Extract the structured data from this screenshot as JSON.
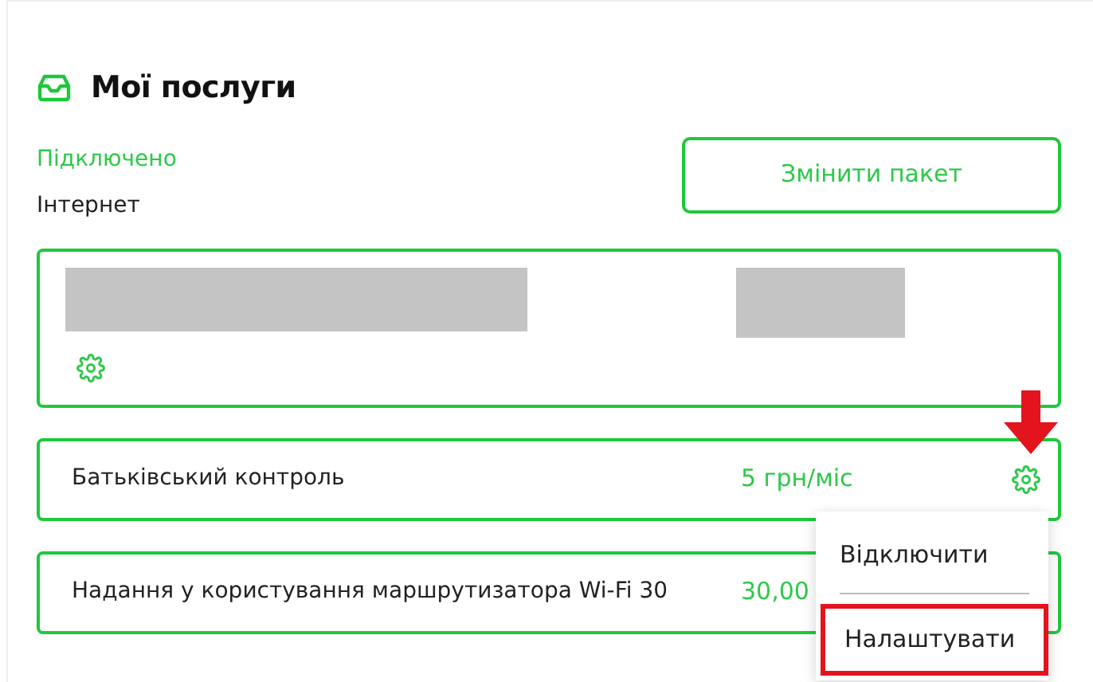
{
  "section": {
    "title": "Мої послуги"
  },
  "status": "Підключено",
  "service_type": "Інтернет",
  "change_button": "Змінити пакет",
  "services": [
    {
      "kind": "redacted"
    },
    {
      "kind": "addon",
      "name": "Батьківський контроль",
      "price": "5 грн/міс",
      "pointed": true
    },
    {
      "kind": "addon",
      "name": "Надання у користування маршрутизатора Wi-Fi 30",
      "price": "30,00",
      "pointed": false
    }
  ],
  "menu": {
    "items": [
      {
        "label": "Відключити",
        "highlighted": false
      },
      {
        "label": "Налаштувати",
        "highlighted": true
      }
    ]
  }
}
